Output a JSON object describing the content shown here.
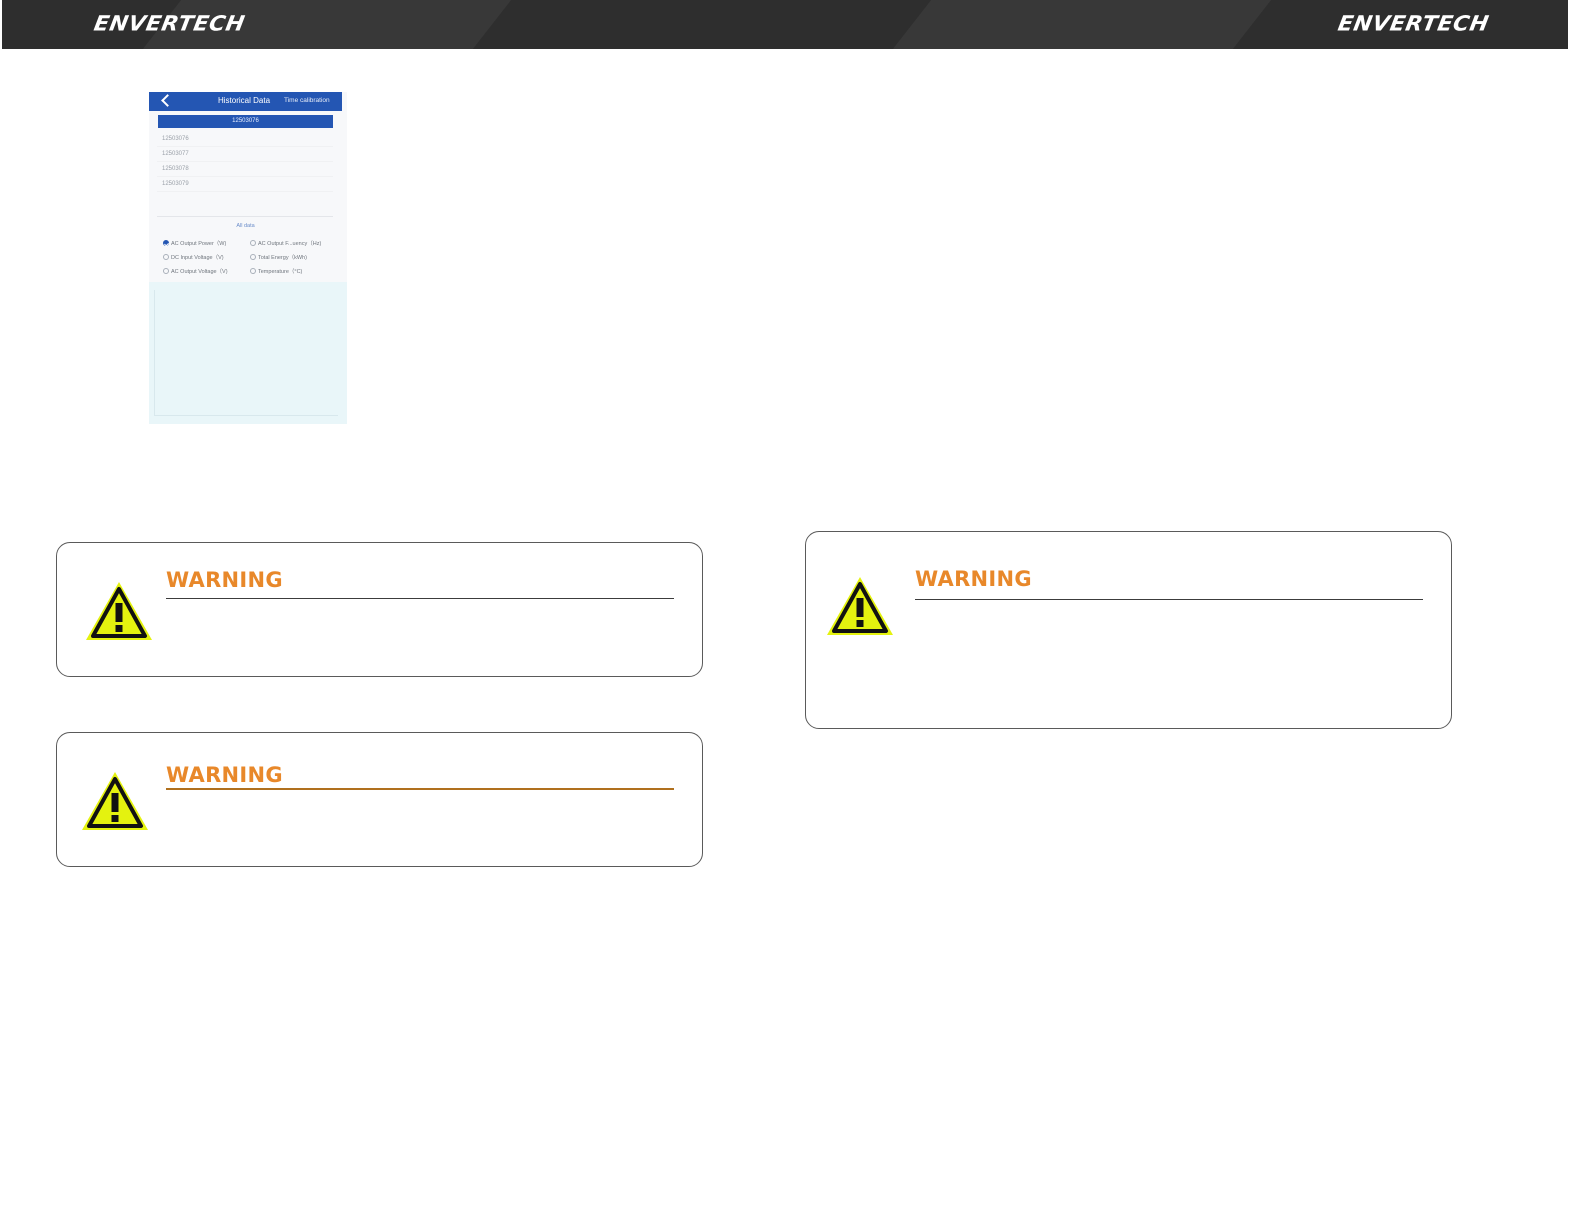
{
  "header": {
    "logo_left": "ENVERTECH",
    "logo_right": "ENVERTECH"
  },
  "phone": {
    "title": "Historical Data",
    "time_calibration": "Time calibration",
    "selected_sn": "12503076",
    "sn_list": [
      "12503076",
      "12503077",
      "12503078",
      "12503079"
    ],
    "all_data_label": "All data",
    "params": [
      {
        "label": "AC Output Power（W)",
        "checked": true
      },
      {
        "label": "AC Output F...uency（Hz)",
        "checked": false
      },
      {
        "label": "DC Input Voltage（V)",
        "checked": false
      },
      {
        "label": "Total Energy（kWh)",
        "checked": false
      },
      {
        "label": "AC Output Voltage（V)",
        "checked": false
      },
      {
        "label": "Temperature（°C)",
        "checked": false
      }
    ]
  },
  "warnings": [
    {
      "title": "WARNING"
    },
    {
      "title": "WARNING"
    },
    {
      "title": "WARNING"
    }
  ],
  "colors": {
    "header_bg": "#2e2e2e",
    "phone_blue": "#2456b3",
    "warning_orange": "#e8882a",
    "warning_yellow": "#e4f20f"
  }
}
